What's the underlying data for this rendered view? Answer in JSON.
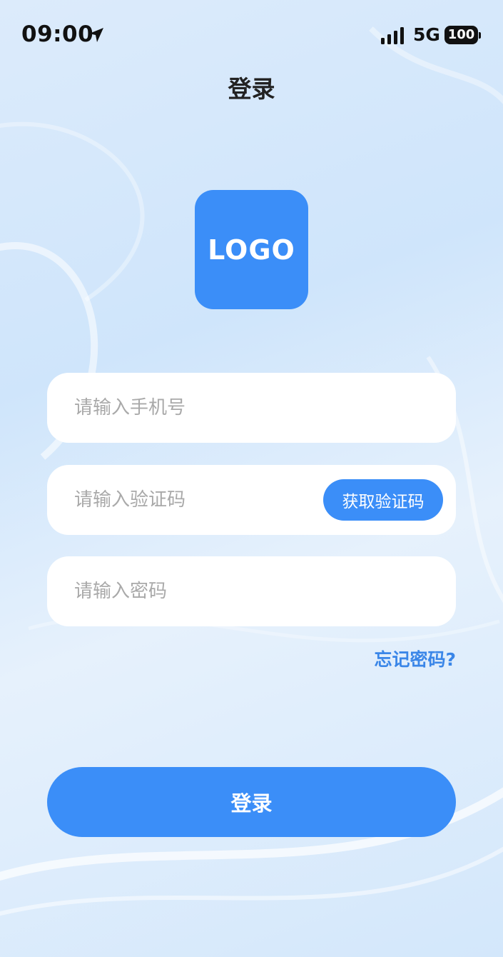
{
  "status_bar": {
    "time": "09:00",
    "network": "5G",
    "battery": "100",
    "icons": [
      "location-arrow-icon",
      "signal-bars-icon",
      "battery-icon"
    ]
  },
  "header": {
    "title": "登录"
  },
  "logo": {
    "text": "LOGO",
    "color": "#3b8ef8"
  },
  "form": {
    "phone_placeholder": "请输入手机号",
    "code_placeholder": "请输入验证码",
    "get_code_label": "获取验证码",
    "password_placeholder": "请输入密码",
    "forgot_label": "忘记密码?",
    "login_label": "登录"
  },
  "colors": {
    "accent": "#3b8ef8",
    "link": "#3a86e8",
    "background": "#d6e8fb"
  }
}
